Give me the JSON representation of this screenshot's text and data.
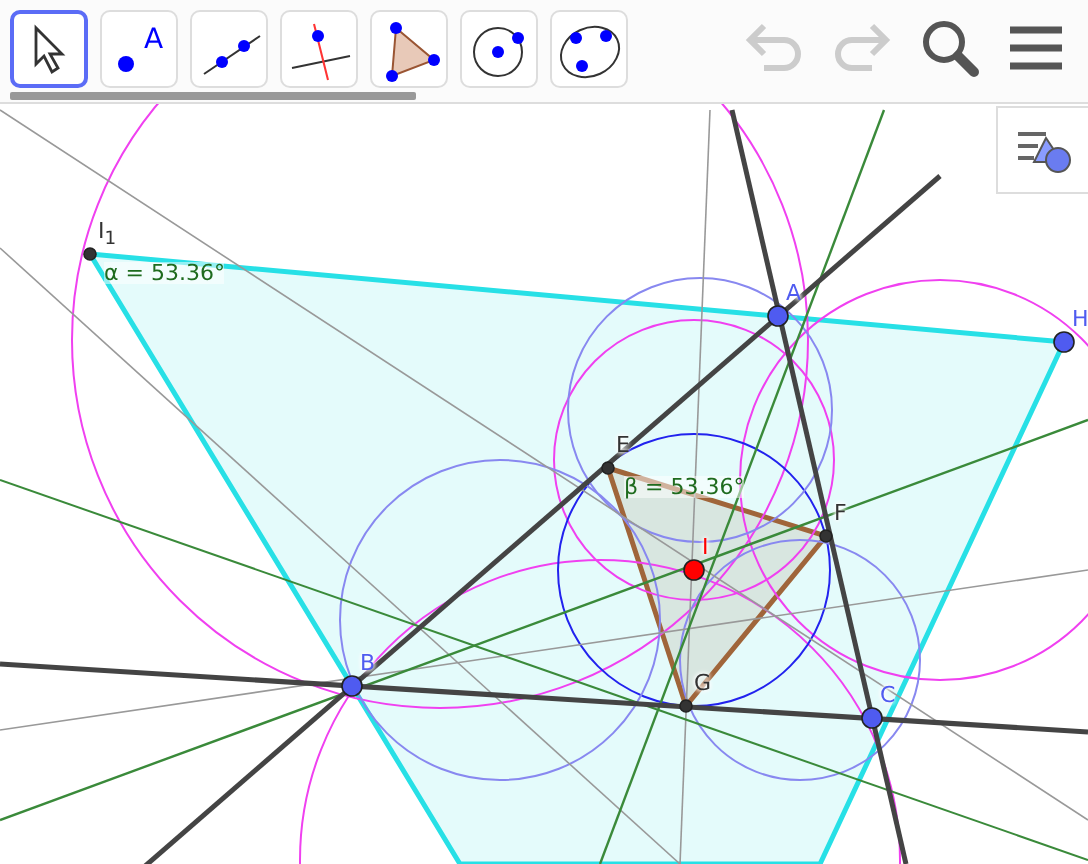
{
  "toolbar": {
    "tools": [
      {
        "kind": "move",
        "selected": true
      },
      {
        "kind": "point",
        "selected": false,
        "label": "A"
      },
      {
        "kind": "line",
        "selected": false
      },
      {
        "kind": "perpendicular",
        "selected": false
      },
      {
        "kind": "polygon",
        "selected": false
      },
      {
        "kind": "circle",
        "selected": false
      },
      {
        "kind": "conic",
        "selected": false
      }
    ],
    "undo": {
      "disabled": true
    },
    "redo": {
      "disabled": true
    }
  },
  "canvas": {
    "points": [
      {
        "label": "I$_{1}$",
        "color": "#333333",
        "kind": "derived"
      },
      {
        "label": "A",
        "color": "#4f5bf0",
        "kind": "free"
      },
      {
        "label": "H",
        "color": "#4f5bf0",
        "kind": "free"
      },
      {
        "label": "E",
        "color": "#333333",
        "kind": "derived"
      },
      {
        "label": "F",
        "color": "#333333",
        "kind": "derived"
      },
      {
        "label": "I",
        "color": "#ff0000",
        "kind": "free"
      },
      {
        "label": "B",
        "color": "#4f5bf0",
        "kind": "free"
      },
      {
        "label": "G",
        "color": "#333333",
        "kind": "derived"
      },
      {
        "label": "C",
        "color": "#4f5bf0",
        "kind": "free"
      }
    ],
    "angles": [
      {
        "text": "α = 53.36°"
      },
      {
        "text": "β = 53.36°"
      }
    ]
  }
}
